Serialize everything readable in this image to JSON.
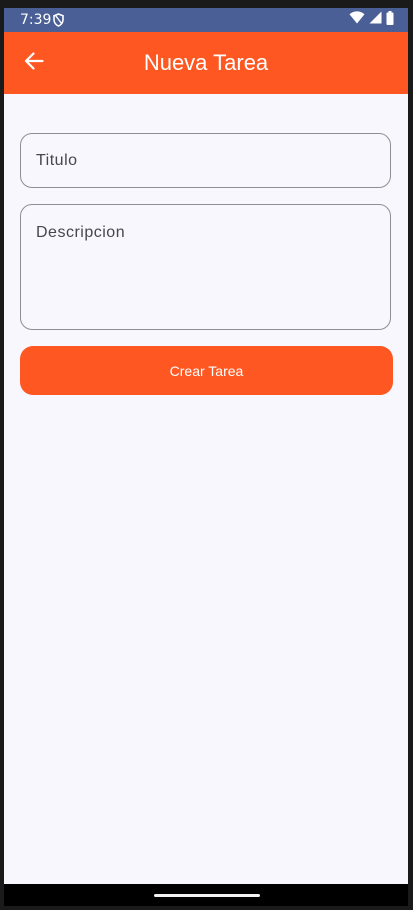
{
  "status_bar": {
    "time": "7:39",
    "icons": [
      "shield-icon",
      "wifi-icon",
      "signal-icon",
      "battery-icon"
    ]
  },
  "app_bar": {
    "title": "Nueva Tarea",
    "back_icon": "arrow-left-icon"
  },
  "form": {
    "title_placeholder": "Titulo",
    "description_placeholder": "Descripcion",
    "submit_label": "Crear Tarea"
  },
  "colors": {
    "status_bar": "#4a5f96",
    "primary": "#ff5722",
    "background": "#f8f7fd",
    "on_primary": "#ffffff",
    "field_border": "#8e8e96"
  }
}
